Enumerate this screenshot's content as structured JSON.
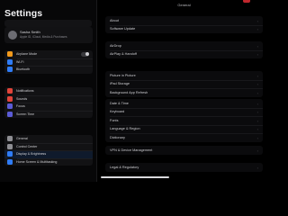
{
  "sidebar": {
    "title": "Settings",
    "profile": {
      "name": "Sasha Smith",
      "subtitle": "Apple ID, iCloud, Media & Purchases"
    },
    "group1": [
      {
        "label": "Airplane Mode",
        "icon": "airplane-icon",
        "color": "#f29a1c",
        "toggle": true
      },
      {
        "label": "Wi-Fi",
        "icon": "wifi-icon",
        "color": "#2f7cf6"
      },
      {
        "label": "Bluetooth",
        "icon": "bluetooth-icon",
        "color": "#2f7cf6"
      }
    ],
    "group2": [
      {
        "label": "Notifications",
        "icon": "bell-icon",
        "color": "#e0443a"
      },
      {
        "label": "Sounds",
        "icon": "speaker-icon",
        "color": "#e0443a"
      },
      {
        "label": "Focus",
        "icon": "moon-icon",
        "color": "#5b5bd6"
      },
      {
        "label": "Screen Time",
        "icon": "hourglass-icon",
        "color": "#5b5bd6"
      }
    ],
    "group3": [
      {
        "label": "General",
        "icon": "gear-icon",
        "color": "#8e8e93"
      },
      {
        "label": "Control Center",
        "icon": "switches-icon",
        "color": "#8e8e93"
      },
      {
        "label": "Display & Brightness",
        "icon": "brightness-icon",
        "color": "#2f7cf6",
        "active": true
      },
      {
        "label": "Home Screen & Multitasking",
        "icon": "grid-icon",
        "color": "#2f7cf6"
      }
    ]
  },
  "detail": {
    "nav_title": "General",
    "groups": [
      [
        "About",
        "Software Update"
      ],
      [
        "AirDrop",
        "AirPlay & Handoff"
      ],
      [
        "Picture in Picture",
        "iPad Storage",
        "Background App Refresh"
      ],
      [
        "Date & Time",
        "Keyboard",
        "Fonts",
        "Language & Region",
        "Dictionary"
      ],
      [
        "VPN & Device Management"
      ],
      [
        "Legal & Regulatory"
      ]
    ]
  },
  "colors": {
    "background": "#000000",
    "accent": "#c0272d"
  }
}
